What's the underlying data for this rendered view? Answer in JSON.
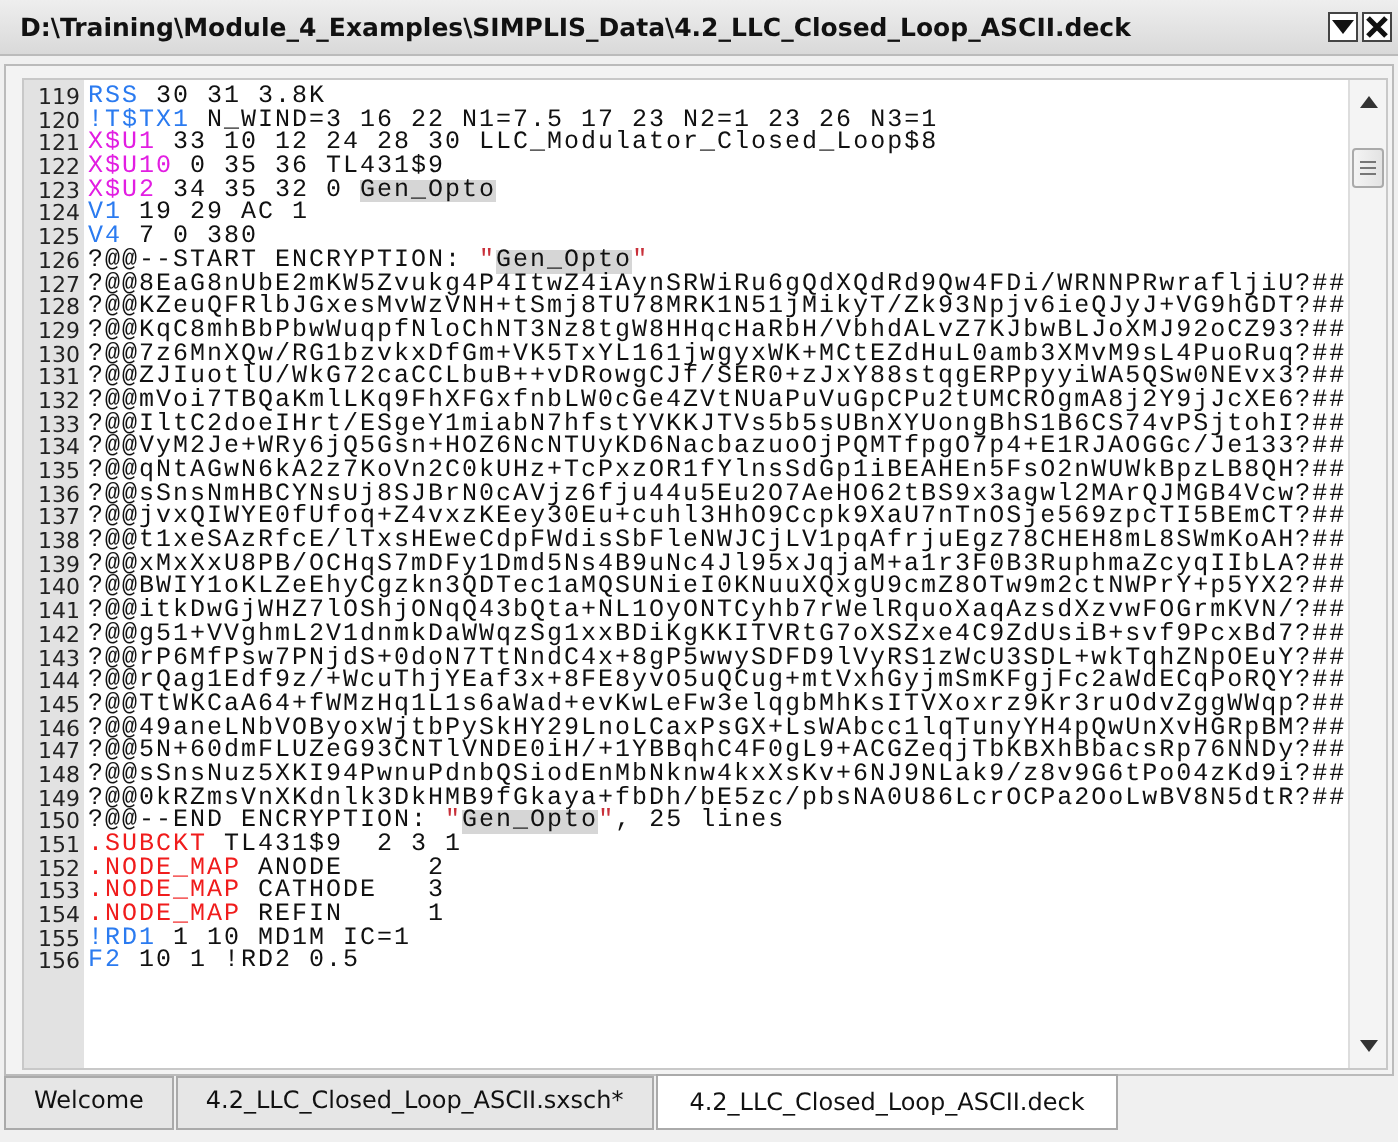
{
  "window": {
    "title": "D:\\Training\\Module_4_Examples\\SIMPLIS_Data\\4.2_LLC_Closed_Loop_ASCII.deck"
  },
  "editor": {
    "lines": [
      {
        "number": "119",
        "segments": [
          {
            "kind": "keyword",
            "color": "#2b7bf0",
            "text": "RSS"
          },
          {
            "kind": "plain",
            "text": " 30 31 3.8K"
          }
        ]
      },
      {
        "number": "120",
        "segments": [
          {
            "kind": "keyword",
            "color": "#2b7bf0",
            "text": "!T$TX1"
          },
          {
            "kind": "plain",
            "text": " N_WIND=3 16 22 N1=7.5 17 23 N2=1 23 26 N3=1"
          }
        ]
      },
      {
        "number": "121",
        "segments": [
          {
            "kind": "keyword",
            "color": "#e21ee2",
            "text": "X$U1"
          },
          {
            "kind": "plain",
            "text": " 33 10 12 24 28 30 LLC_Modulator_Closed_Loop$8"
          }
        ]
      },
      {
        "number": "122",
        "segments": [
          {
            "kind": "keyword",
            "color": "#e21ee2",
            "text": "X$U10"
          },
          {
            "kind": "plain",
            "text": " 0 35 36 TL431$9"
          }
        ]
      },
      {
        "number": "123",
        "segments": [
          {
            "kind": "keyword",
            "color": "#e21ee2",
            "text": "X$U2"
          },
          {
            "kind": "plain",
            "text": " 34 35 32 0 "
          },
          {
            "kind": "highlight",
            "text": "Gen_Opto"
          }
        ]
      },
      {
        "number": "124",
        "segments": [
          {
            "kind": "keyword",
            "color": "#2b7bf0",
            "text": "V1"
          },
          {
            "kind": "plain",
            "text": " 19 29 AC 1"
          }
        ]
      },
      {
        "number": "125",
        "segments": [
          {
            "kind": "keyword",
            "color": "#2b7bf0",
            "text": "V4"
          },
          {
            "kind": "plain",
            "text": " 7 0 380"
          }
        ]
      },
      {
        "number": "126",
        "segments": [
          {
            "kind": "plain",
            "text": "?@@--START ENCRYPTION: "
          },
          {
            "kind": "keyword",
            "color": "#c8303a",
            "text": "\""
          },
          {
            "kind": "highlight",
            "text": "Gen_Opto"
          },
          {
            "kind": "keyword",
            "color": "#c8303a",
            "text": "\""
          }
        ]
      },
      {
        "number": "127",
        "segments": [
          {
            "kind": "plain",
            "text": "?@@8EaG8nUbE2mKW5Zvukg4P4ItwZ4iAynSRWiRu6gQdXQdRd9Qw4FDi/WRNNPRwrafljiU?##"
          }
        ]
      },
      {
        "number": "128",
        "segments": [
          {
            "kind": "plain",
            "text": "?@@KZeuQFRlbJGxesMvWzVNH+tSmj8TU78MRK1N51jMikyT/Zk93Npjv6ieQJyJ+VG9hGDT?##"
          }
        ]
      },
      {
        "number": "129",
        "segments": [
          {
            "kind": "plain",
            "text": "?@@KqC8mhBbPbwWuqpfNloChNT3Nz8tgW8HHqcHaRbH/VbhdALvZ7KJbwBLJoXMJ92oCZ93?##"
          }
        ]
      },
      {
        "number": "130",
        "segments": [
          {
            "kind": "plain",
            "text": "?@@7z6MnXQw/RG1bzvkxDfGm+VK5TxYL161jwgyxWK+MCtEZdHuL0amb3XMvM9sL4PuoRuq?##"
          }
        ]
      },
      {
        "number": "131",
        "segments": [
          {
            "kind": "plain",
            "text": "?@@ZJIuotlU/WkG72caCCLbuB++vDRowgCJf/SER0+zJxY88stqgERPpyyiWA5QSw0NEvx3?##"
          }
        ]
      },
      {
        "number": "132",
        "segments": [
          {
            "kind": "plain",
            "text": "?@@mVoi7TBQaKmlLKq9FhXFGxfnbLW0cGe4ZVtNUaPuVuGpCPu2tUMCROgmA8j2Y9jJcXE6?##"
          }
        ]
      },
      {
        "number": "133",
        "segments": [
          {
            "kind": "plain",
            "text": "?@@IltC2doeIHrt/ESgeY1miabN7hfstYVKKJTVs5b5sUBnXYUongBhS1B6CS74vPSjtohI?##"
          }
        ]
      },
      {
        "number": "134",
        "segments": [
          {
            "kind": "plain",
            "text": "?@@VyM2Je+WRy6jQ5Gsn+HOZ6NcNTUyKD6NacbazuoOjPQMTfpgO7p4+E1RJAOGGc/Je133?##"
          }
        ]
      },
      {
        "number": "135",
        "segments": [
          {
            "kind": "plain",
            "text": "?@@qNtAGwN6kA2z7KoVn2C0kUHz+TcPxzOR1fYlnsSdGp1iBEAHEn5FsO2nWUWkBpzLB8QH?##"
          }
        ]
      },
      {
        "number": "136",
        "segments": [
          {
            "kind": "plain",
            "text": "?@@sSnsNmHBCYNsUj8SJBrN0cAVjz6fju44u5Eu2O7AeHO62tBS9x3agwl2MArQJMGB4Vcw?##"
          }
        ]
      },
      {
        "number": "137",
        "segments": [
          {
            "kind": "plain",
            "text": "?@@jvxQIWYE0fUfoq+Z4vxzKEey30Eu+cuhl3HhO9Ccpk9XaU7nTnOSje569zpcTI5BEmCT?##"
          }
        ]
      },
      {
        "number": "138",
        "segments": [
          {
            "kind": "plain",
            "text": "?@@t1xeSAzRfcE/lTxsHEweCdpFWdisSbFleNWJCjLV1pqAfrjuEgz78CHEH8mL8SWmKoAH?##"
          }
        ]
      },
      {
        "number": "139",
        "segments": [
          {
            "kind": "plain",
            "text": "?@@xMxXxU8PB/OCHqS7mDFy1Dmd5Ns4B9uNc4Jl95xJqjaM+a1r3F0B3RuphmaZcyqIIbLA?##"
          }
        ]
      },
      {
        "number": "140",
        "segments": [
          {
            "kind": "plain",
            "text": "?@@BWIY1oKLZeEhyCgzkn3QDTec1aMQSUNieI0KNuuXQxgU9cmZ8OTw9m2ctNWPrY+p5YX2?##"
          }
        ]
      },
      {
        "number": "141",
        "segments": [
          {
            "kind": "plain",
            "text": "?@@itkDwGjWHZ7lOShjONqQ43bQta+NL1OyONTCyhb7rWelRquoXaqAzsdXzvwFOGrmKVN/?##"
          }
        ]
      },
      {
        "number": "142",
        "segments": [
          {
            "kind": "plain",
            "text": "?@@g51+VVghmL2V1dnmkDaWWqzSg1xxBDiKgKKITVRtG7oXSZxe4C9ZdUsiB+svf9PcxBd7?##"
          }
        ]
      },
      {
        "number": "143",
        "segments": [
          {
            "kind": "plain",
            "text": "?@@rP6MfPsw7PNjdS+0doN7TtNndC4x+8gP5wwySDFD9lVyRS1zWcU3SDL+wkTqhZNpOEuY?##"
          }
        ]
      },
      {
        "number": "144",
        "segments": [
          {
            "kind": "plain",
            "text": "?@@rQag1Edf9z/+WcuThjYEaf3x+8FE8yvO5uQCug+mtVxhGyjmSmKFgjFc2aWdECqPoRQY?##"
          }
        ]
      },
      {
        "number": "145",
        "segments": [
          {
            "kind": "plain",
            "text": "?@@TtWKCaA64+fWMzHq1L1s6aWad+evKwLeFw3elqgbMhKsITVXoxrz9Kr3ruOdvZggWWqp?##"
          }
        ]
      },
      {
        "number": "146",
        "segments": [
          {
            "kind": "plain",
            "text": "?@@49aneLNbVOByoxWjtbPySkHY29LnoLCaxPsGX+LsWAbcc1lqTunyYH4pQwUnXvHGRpBM?##"
          }
        ]
      },
      {
        "number": "147",
        "segments": [
          {
            "kind": "plain",
            "text": "?@@5N+60dmFLUZeG93CNTlVNDE0iH/+1YBBqhC4F0gL9+ACGZeqjTbKBXhBbacsRp76NNDy?##"
          }
        ]
      },
      {
        "number": "148",
        "segments": [
          {
            "kind": "plain",
            "text": "?@@sSnsNuz5XKI94PwnuPdnbQSiodEnMbNknw4kxXsKv+6NJ9NLak9/z8v9G6tPo04zKd9i?##"
          }
        ]
      },
      {
        "number": "149",
        "segments": [
          {
            "kind": "plain",
            "text": "?@@0kRZmsVnXKdnlk3DkHMB9fGkaya+fbDh/bE5zc/pbsNA0U86LcrOCPa2OoLwBV8N5dtR?##"
          }
        ]
      },
      {
        "number": "150",
        "segments": [
          {
            "kind": "plain",
            "text": "?@@--END ENCRYPTION: "
          },
          {
            "kind": "keyword",
            "color": "#c8303a",
            "text": "\""
          },
          {
            "kind": "highlight",
            "text": "Gen_Opto"
          },
          {
            "kind": "keyword",
            "color": "#c8303a",
            "text": "\""
          },
          {
            "kind": "plain",
            "text": ", 25 lines"
          }
        ]
      },
      {
        "number": "151",
        "segments": [
          {
            "kind": "keyword",
            "color": "#f01c1c",
            "text": ".SUBCKT"
          },
          {
            "kind": "plain",
            "text": " TL431$9  2 3 1"
          }
        ]
      },
      {
        "number": "152",
        "segments": [
          {
            "kind": "keyword",
            "color": "#f01c1c",
            "text": ".NODE_MAP"
          },
          {
            "kind": "plain",
            "text": " ANODE     2"
          }
        ]
      },
      {
        "number": "153",
        "segments": [
          {
            "kind": "keyword",
            "color": "#f01c1c",
            "text": ".NODE_MAP"
          },
          {
            "kind": "plain",
            "text": " CATHODE   3"
          }
        ]
      },
      {
        "number": "154",
        "segments": [
          {
            "kind": "keyword",
            "color": "#f01c1c",
            "text": ".NODE_MAP"
          },
          {
            "kind": "plain",
            "text": " REFIN     1"
          }
        ]
      },
      {
        "number": "155",
        "segments": [
          {
            "kind": "keyword",
            "color": "#2b7bf0",
            "text": "!RD1"
          },
          {
            "kind": "plain",
            "text": " 1 10 MD1M IC=1"
          }
        ]
      },
      {
        "number": "156",
        "segments": [
          {
            "kind": "keyword",
            "color": "#2b7bf0",
            "text": "F2"
          },
          {
            "kind": "plain",
            "text": " 10 1 !RD2 0.5"
          }
        ]
      }
    ]
  },
  "tabs": [
    {
      "label": "Welcome",
      "selected": false
    },
    {
      "label": "4.2_LLC_Closed_Loop_ASCII.sxsch*",
      "selected": false
    },
    {
      "label": "4.2_LLC_Closed_Loop_ASCII.deck",
      "selected": true
    }
  ]
}
